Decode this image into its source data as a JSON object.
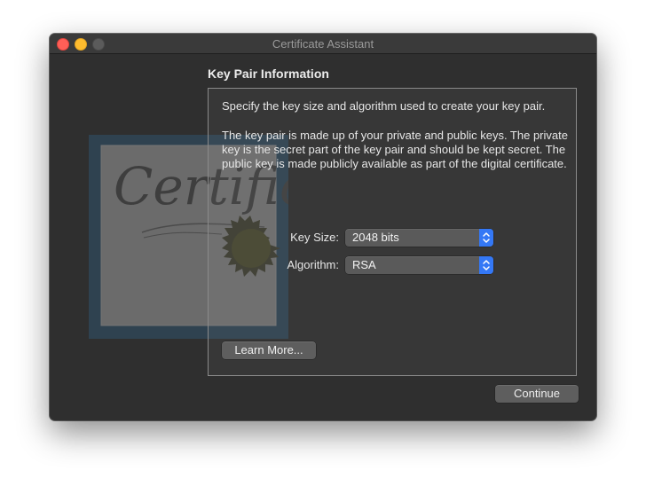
{
  "window": {
    "title": "Certificate Assistant"
  },
  "section": {
    "title": "Key Pair Information"
  },
  "panel": {
    "intro": "Specify the key size and algorithm used to create your key pair.",
    "description": "The key pair is made up of your private and public keys. The private key is the secret part of the key pair and should be kept secret. The public key is made publicly available as part of the digital certificate."
  },
  "fields": {
    "key_size": {
      "label": "Key Size:",
      "value": "2048 bits"
    },
    "algorithm": {
      "label": "Algorithm:",
      "value": "RSA"
    }
  },
  "buttons": {
    "learn_more": "Learn More...",
    "continue": "Continue"
  },
  "illustration": {
    "text": "Certificate"
  },
  "colors": {
    "window_bg": "#2f2f2f",
    "accent": "#3478f6",
    "close": "#fe5f57",
    "minimize": "#febc2e"
  }
}
